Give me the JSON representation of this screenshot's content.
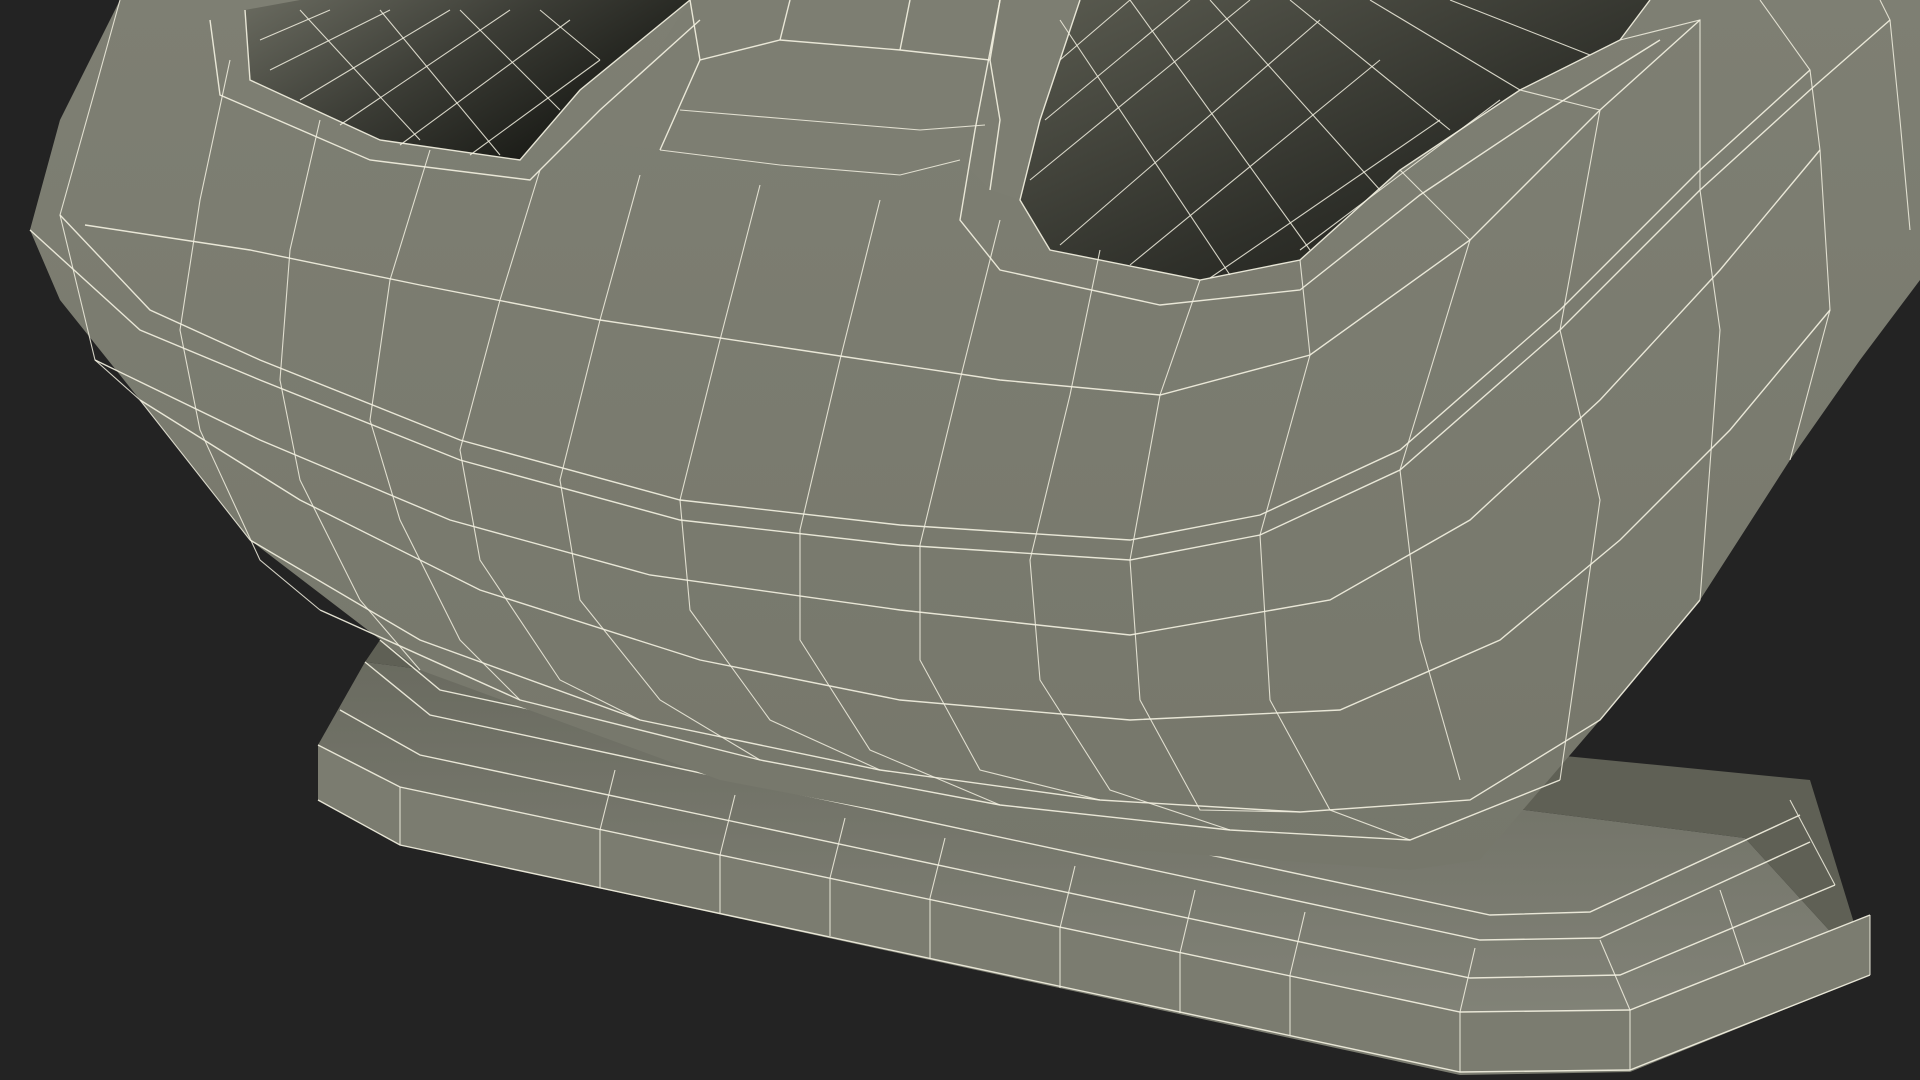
{
  "viewport": {
    "background_color": "#232323"
  },
  "model": {
    "subject": "wireframe-3d-mesh",
    "surface_color": "#7a7b6f",
    "surface_light_color": "#84857a",
    "surface_dark_color": "#5d5e53",
    "cavity_color": "#2a2b25",
    "wire_color": "#f2f0e0"
  }
}
